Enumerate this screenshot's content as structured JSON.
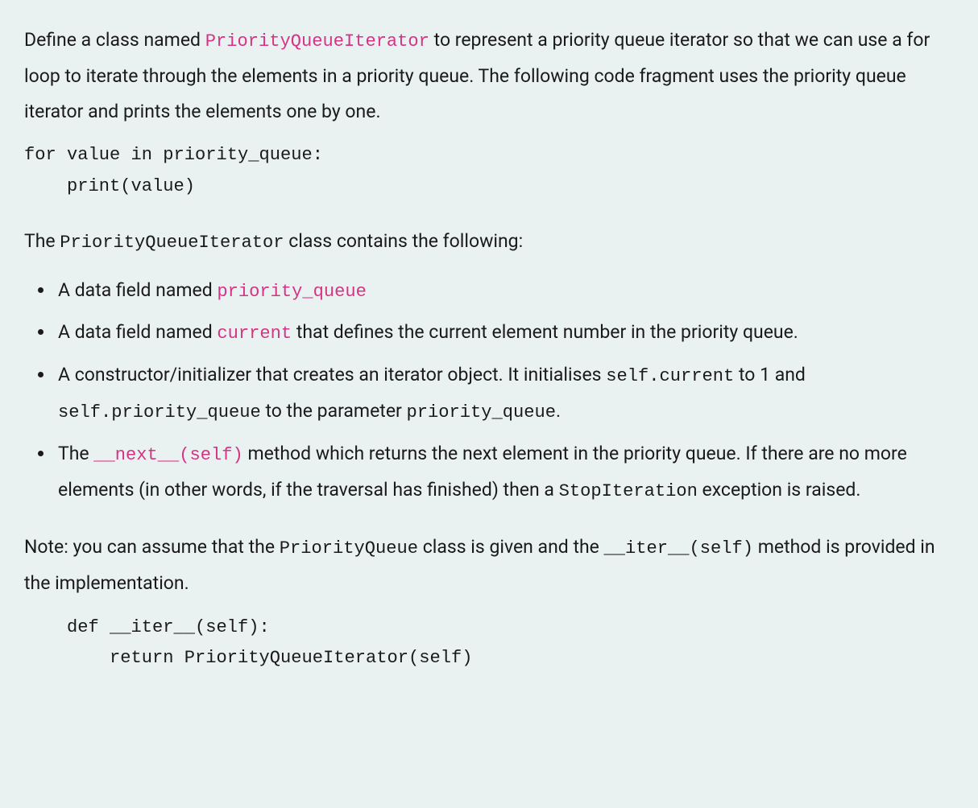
{
  "para1": {
    "pre": "Define a class named ",
    "class_name": "PriorityQueueIterator",
    "post": " to represent a priority queue iterator so that we can use a for loop to iterate through the elements in a priority queue. The following code fragment uses the priority queue iterator and prints the elements one by one."
  },
  "code1": "for value in priority_queue:\n    print(value)",
  "para2": {
    "pre": "The ",
    "class_name": "PriorityQueueIterator",
    "post": " class contains the following:"
  },
  "bullets": {
    "b1": {
      "pre": "A data field named ",
      "hl": "priority_queue"
    },
    "b2": {
      "pre": "A data field named ",
      "hl": "current",
      "post": " that defines the current element number in the priority queue."
    },
    "b3": {
      "pre": "A constructor/initializer that creates an iterator object. It initialises ",
      "c1": "self.current",
      "mid1": " to 1 and ",
      "c2": "self.priority_queue",
      "mid2": " to the parameter ",
      "c3": "priority_queue",
      "post": "."
    },
    "b4": {
      "pre": "The ",
      "hl": "__next__(self)",
      "mid": " method which returns the next element in the priority queue. If there are no more elements (in other words, if the traversal has finished) then a ",
      "c1": "StopIteration",
      "post": " exception is raised."
    }
  },
  "para3": {
    "pre": "Note: you can assume that the ",
    "c1": "PriorityQueue",
    "mid": " class is given and the ",
    "c2": "__iter__(self)",
    "post": " method is provided in the implementation."
  },
  "code2": "    def __iter__(self):\n        return PriorityQueueIterator(self)"
}
